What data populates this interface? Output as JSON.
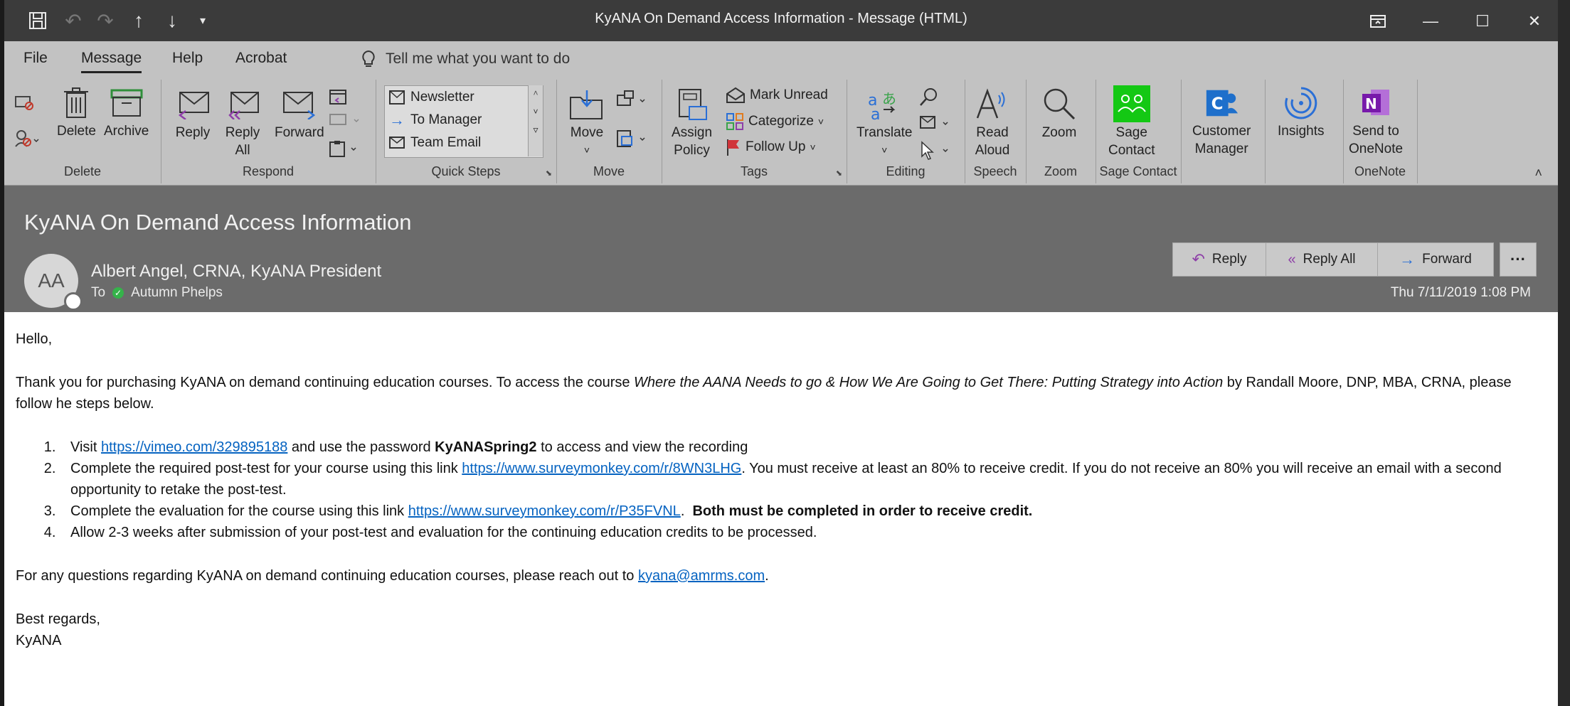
{
  "window": {
    "title": "KyANA On Demand Access Information  -  Message (HTML)"
  },
  "menu": {
    "items": [
      "File",
      "Message",
      "Help",
      "Acrobat"
    ],
    "tell_me": "Tell me what you want to do"
  },
  "ribbon": {
    "delete_group": {
      "label": "Delete",
      "delete": "Delete",
      "archive": "Archive"
    },
    "respond_group": {
      "label": "Respond",
      "reply": "Reply",
      "reply_all_1": "Reply",
      "reply_all_2": "All",
      "forward": "Forward"
    },
    "quick_steps": {
      "label": "Quick Steps",
      "items": [
        "Newsletter",
        "To Manager",
        "Team Email"
      ]
    },
    "move_group": {
      "label": "Move",
      "move": "Move"
    },
    "tags_group": {
      "label": "Tags",
      "assign_1": "Assign",
      "assign_2": "Policy",
      "mark_unread": "Mark Unread",
      "categorize": "Categorize",
      "follow_up": "Follow Up"
    },
    "editing_group": {
      "label": "Editing",
      "translate": "Translate"
    },
    "speech_group": {
      "label": "Speech",
      "read_1": "Read",
      "read_2": "Aloud"
    },
    "zoom_group": {
      "label": "Zoom",
      "zoom": "Zoom"
    },
    "sage_group": {
      "label": "Sage Contact",
      "sage_1": "Sage",
      "sage_2": "Contact"
    },
    "customer": {
      "line1": "Customer",
      "line2": "Manager"
    },
    "insights": {
      "label": "Insights"
    },
    "onenote_group": {
      "label": "OneNote",
      "send_1": "Send to",
      "send_2": "OneNote"
    }
  },
  "header": {
    "subject": "KyANA On Demand Access Information",
    "avatar_initials": "AA",
    "sender": "Albert Angel, CRNA, KyANA President",
    "to_label": "To",
    "recipient": "Autumn Phelps",
    "reply": "Reply",
    "reply_all": "Reply All",
    "forward": "Forward",
    "more": "···",
    "date": "Thu 7/11/2019 1:08 PM"
  },
  "body": {
    "greeting": "Hello,",
    "intro_1": "Thank you for purchasing KyANA on demand continuing education courses.  To access the course ",
    "intro_italic": "Where the AANA Needs to go & How We Are Going to Get There:  Putting Strategy into Action",
    "intro_2": " by Randall Moore, DNP, MBA, CRNA, please follow he steps below.",
    "step1_a": "Visit ",
    "step1_link": "https://vimeo.com/329895188",
    "step1_b": " and use the password ",
    "step1_bold": "KyANASpring2",
    "step1_c": " to access and view the recording",
    "step2_a": "Complete the required post-test for your course using this link ",
    "step2_link": "https://www.surveymonkey.com/r/8WN3LHG",
    "step2_b": ".  You must receive at least an 80% to receive credit.  If you do not receive an 80% you will receive an email with a second opportunity to retake the post-test.",
    "step3_a": "Complete the evaluation for the course using this link ",
    "step3_link": "https://www.surveymonkey.com/r/P35FVNL",
    "step3_b": ".  ",
    "step3_bold": "Both must be completed in order to receive credit.",
    "step4": "Allow 2-3 weeks after submission of your post-test and evaluation for the continuing education credits to be processed.",
    "questions_a": "For any questions regarding KyANA on demand continuing education courses, please reach out to ",
    "questions_link": "kyana@amrms.com",
    "questions_b": ".",
    "closing": "Best regards,",
    "signature": "KyANA"
  }
}
